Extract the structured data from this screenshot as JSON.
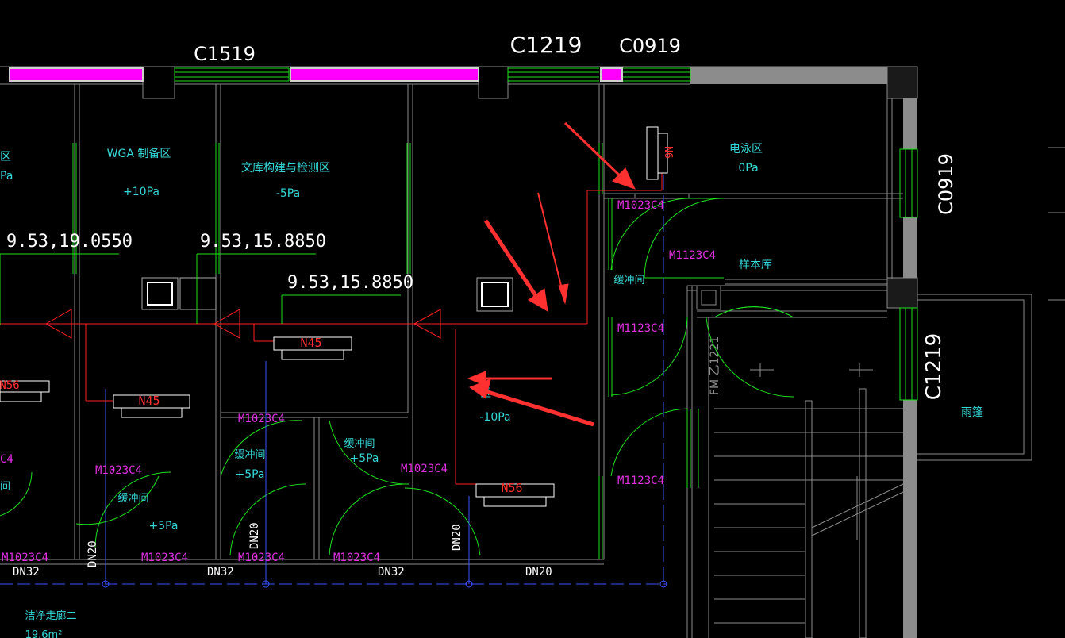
{
  "colors": {
    "background": "#000000",
    "wall": "#8c8c8c",
    "window_green": "#1fe01f",
    "glass_magenta": "#ff00ff",
    "pipe_red": "#ff2020",
    "axis_blue": "#3a55ff",
    "room_text": "#36d6d6",
    "door_text": "#e030e0",
    "dim_text": "#ffffff",
    "door_arc": "#1fe01f",
    "annotation_arrow": "#ff3030"
  },
  "windows": [
    "C1519",
    "C1219",
    "C0919",
    "C0919",
    "C1219"
  ],
  "rooms": [
    {
      "name": "区",
      "pressure": "Pa"
    },
    {
      "name": "WGA 制备区",
      "pressure": "+10Pa"
    },
    {
      "name": "文库构建与检测区",
      "pressure": "-5Pa"
    },
    {
      "name": "电泳区",
      "pressure": "0Pa"
    },
    {
      "name": "样本库",
      "pressure": ""
    },
    {
      "name": "缓冲间",
      "pressure": ""
    },
    {
      "name": "区",
      "pressure": "-10Pa"
    },
    {
      "name": "缓冲间",
      "pressure": "+5Pa"
    },
    {
      "name": "缓冲间",
      "pressure": "+5Pa"
    },
    {
      "name": "缓冲间",
      "pressure": "+5Pa"
    },
    {
      "name": "雨篷",
      "pressure": ""
    },
    {
      "name": "洁净走廊二",
      "pressure": "19.6m²"
    },
    {
      "name": "间",
      "pressure": ""
    }
  ],
  "doors": [
    "M1023C4",
    "M1123C4",
    "M1123C4",
    "M1123C4",
    "M1023C4",
    "M1023C4",
    "M1023C4",
    "M1023C4",
    "M1023C4",
    "M1023C4",
    "M1023C4",
    "C4",
    "FM 乙1221"
  ],
  "dims": [
    "9.53,19.0550",
    "9.53,15.8850",
    "9.53,15.8850"
  ],
  "equipment": [
    "N45",
    "N45",
    "N56",
    "N56",
    "N6"
  ],
  "pipes": [
    "DN32",
    "DN32",
    "DN32",
    "DN20",
    "DN20",
    "DN20",
    "DN20"
  ]
}
